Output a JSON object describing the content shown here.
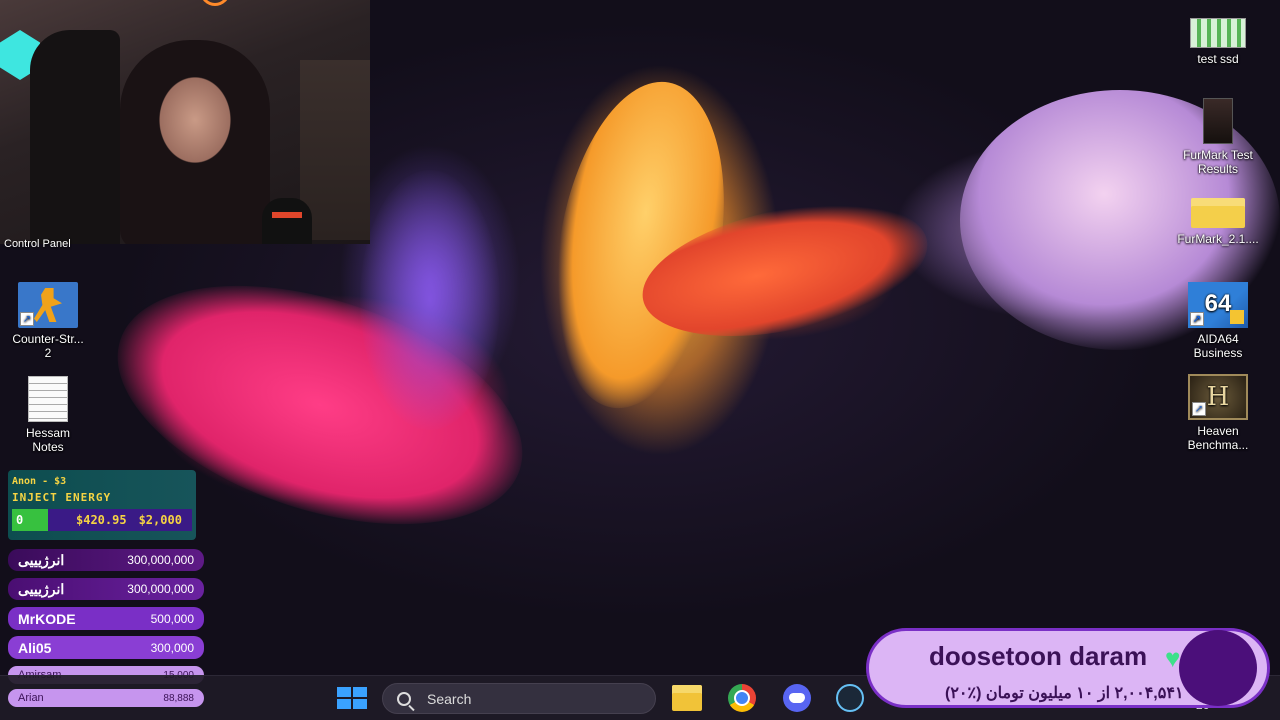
{
  "webcam": {
    "overlay_label": "Control Panel"
  },
  "desktop_icons": {
    "cs2": {
      "label_line1": "Counter-Str...",
      "label_line2": "2"
    },
    "hessam": {
      "label_line1": "Hessam",
      "label_line2": "Notes"
    },
    "test_ssd": {
      "label": "test ssd"
    },
    "furmark_results": {
      "label_line1": "FurMark Test",
      "label_line2": "Results"
    },
    "furmark_folder": {
      "label": "FurMark_2.1...."
    },
    "aida64": {
      "glyph": "64",
      "label_line1": "AIDA64",
      "label_line2": "Business"
    },
    "heaven": {
      "glyph": "H",
      "label_line1": "Heaven",
      "label_line2": "Benchma..."
    }
  },
  "energy_widget": {
    "donor": "Anon - $3",
    "title": "INJECT ENERGY",
    "count": "0",
    "current": "$420.95",
    "goal": "$2,000"
  },
  "donors": [
    {
      "name": "انرژیییی",
      "amount": "300,000,000"
    },
    {
      "name": "انرژیییی",
      "amount": "300,000,000"
    },
    {
      "name": "MrKODE",
      "amount": "500,000"
    },
    {
      "name": "Ali05",
      "amount": "300,000"
    },
    {
      "name": "Amirsam",
      "amount": "15,000"
    },
    {
      "name": "Arian",
      "amount": "88,888"
    }
  ],
  "taskbar": {
    "search_placeholder": "Search",
    "apps": [
      "file-explorer",
      "chrome",
      "discord",
      "steam"
    ]
  },
  "alert": {
    "name": "doosetoon daram",
    "heart": "♥",
    "progress_text": "۲,۰۰۴,۵۴۱ از ۱۰ میلیون تومان (٪۲۰)"
  },
  "clock": {
    "date_partial": "-26"
  },
  "colors": {
    "alert_bg": "#dcb5f5",
    "alert_border": "#7a2fc6",
    "energy_accent": "#f6d443",
    "energy_fill": "#37c13f",
    "windows_blue": "#3aa2ff"
  }
}
